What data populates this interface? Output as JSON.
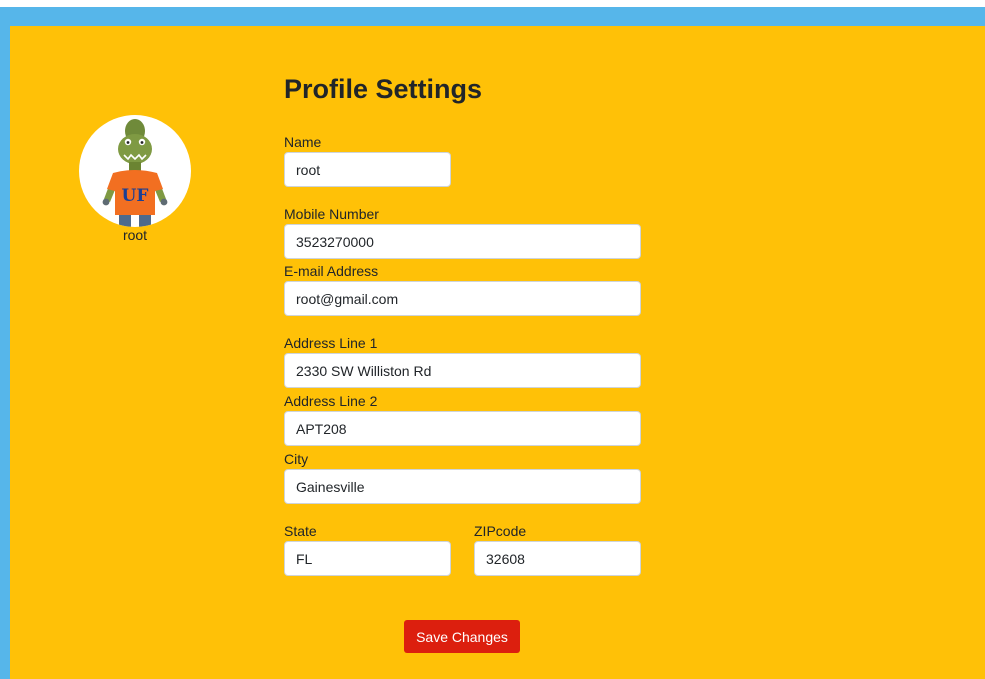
{
  "page": {
    "title": "Profile Settings"
  },
  "profile": {
    "username": "root",
    "avatar_icon": "gator-mascot-avatar-icon",
    "avatar_text": "UF"
  },
  "form": {
    "name": {
      "label": "Name",
      "value": "root"
    },
    "mobile": {
      "label": "Mobile Number",
      "value": "3523270000"
    },
    "email": {
      "label": "E-mail Address",
      "value": "root@gmail.com"
    },
    "address1": {
      "label": "Address Line 1",
      "value": "2330 SW Williston Rd"
    },
    "address2": {
      "label": "Address Line 2",
      "value": "APT208"
    },
    "city": {
      "label": "City",
      "value": "Gainesville"
    },
    "state": {
      "label": "State",
      "value": "FL"
    },
    "zip": {
      "label": "ZIPcode",
      "value": "32608"
    }
  },
  "actions": {
    "save_label": "Save Changes"
  },
  "colors": {
    "frame": "#56b6ea",
    "panel": "#ffc107",
    "button": "#dc1f0e",
    "mascot_shirt": "#f26f21",
    "mascot_text": "#1b3f94"
  }
}
